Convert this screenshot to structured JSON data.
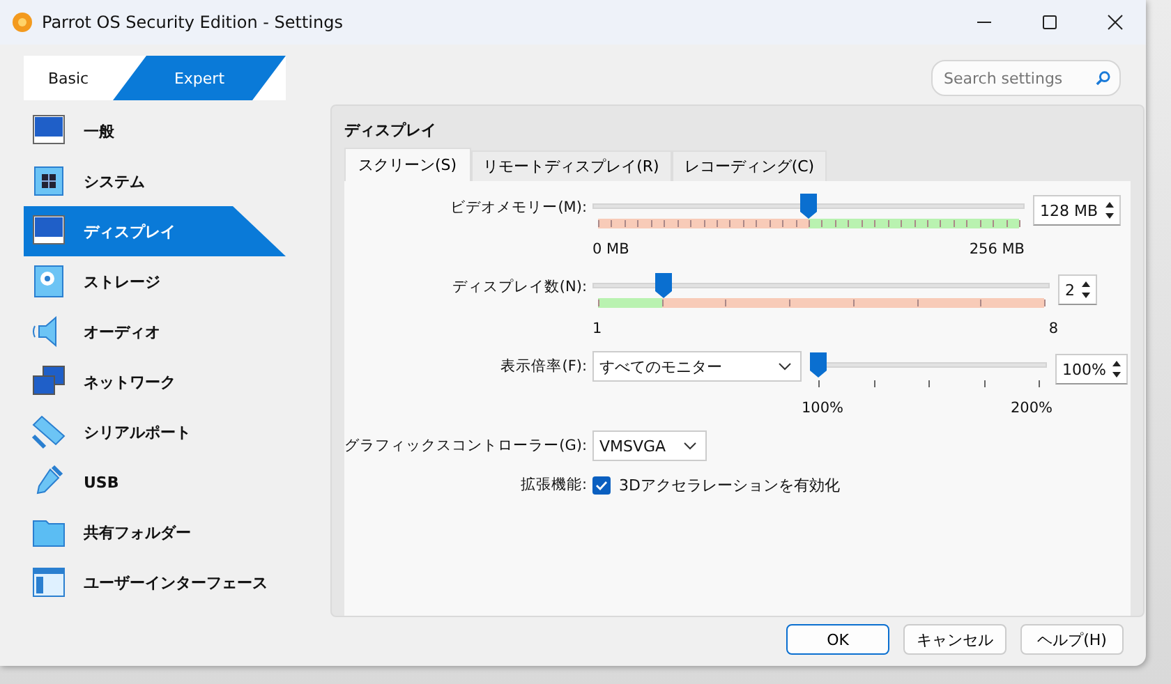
{
  "window": {
    "title": "Parrot OS Security Edition - Settings"
  },
  "mode_tabs": [
    {
      "label": "Basic",
      "selected": false
    },
    {
      "label": "Expert",
      "selected": true
    }
  ],
  "search": {
    "placeholder": "Search settings"
  },
  "sidebar": {
    "items": [
      {
        "label": "一般",
        "selected": false
      },
      {
        "label": "システム",
        "selected": false
      },
      {
        "label": "ディスプレイ",
        "selected": true
      },
      {
        "label": "ストレージ",
        "selected": false
      },
      {
        "label": "オーディオ",
        "selected": false
      },
      {
        "label": "ネットワーク",
        "selected": false
      },
      {
        "label": "シリアルポート",
        "selected": false
      },
      {
        "label": "USB",
        "selected": false
      },
      {
        "label": "共有フォルダー",
        "selected": false
      },
      {
        "label": "ユーザーインターフェース",
        "selected": false
      }
    ]
  },
  "panel": {
    "title": "ディスプレイ",
    "tabs": [
      {
        "label": "スクリーン(S)",
        "selected": true
      },
      {
        "label": "リモートディスプレイ(R)",
        "selected": false
      },
      {
        "label": "レコーディング(C)",
        "selected": false
      }
    ],
    "rows": [
      {
        "kind": "slider",
        "label": "ビデオメモリー(M):",
        "level": 0.5,
        "value": "128 MB",
        "min": "0 MB",
        "max": "256 MB"
      },
      {
        "kind": "slider",
        "label": "ディスプレイ数(N):",
        "level": 0.143,
        "value": "2",
        "min": "1",
        "max": "8"
      },
      {
        "kind": "scale",
        "label": "表示倍率(F):",
        "select": "すべてのモニター",
        "level": 0,
        "value": "100%",
        "min": "100%",
        "max": "200%"
      },
      {
        "kind": "select",
        "label": "グラフィックスコントローラー(G):",
        "select": "VMSVGA"
      },
      {
        "kind": "checkbox",
        "label": "拡張機能:",
        "text": "3Dアクセラレーションを有効化",
        "checked": true
      }
    ]
  },
  "buttons": [
    {
      "label": "OK",
      "default": true
    },
    {
      "label": "キャンセル",
      "default": false
    },
    {
      "label": "ヘルプ(H)",
      "default": false
    }
  ]
}
